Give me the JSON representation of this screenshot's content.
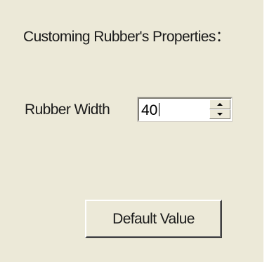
{
  "panel": {
    "heading": "Customing Rubber's Properties：",
    "rubber_width": {
      "label": "Rubber Width",
      "value": "40"
    },
    "default_button_label": "Default Value"
  },
  "icons": {
    "spin_up": "spin-up-arrow-icon",
    "spin_down": "spin-down-arrow-icon"
  },
  "colors": {
    "panel_background": "#ece9d8",
    "field_background": "#ffffff",
    "text": "#1a1a1a"
  }
}
